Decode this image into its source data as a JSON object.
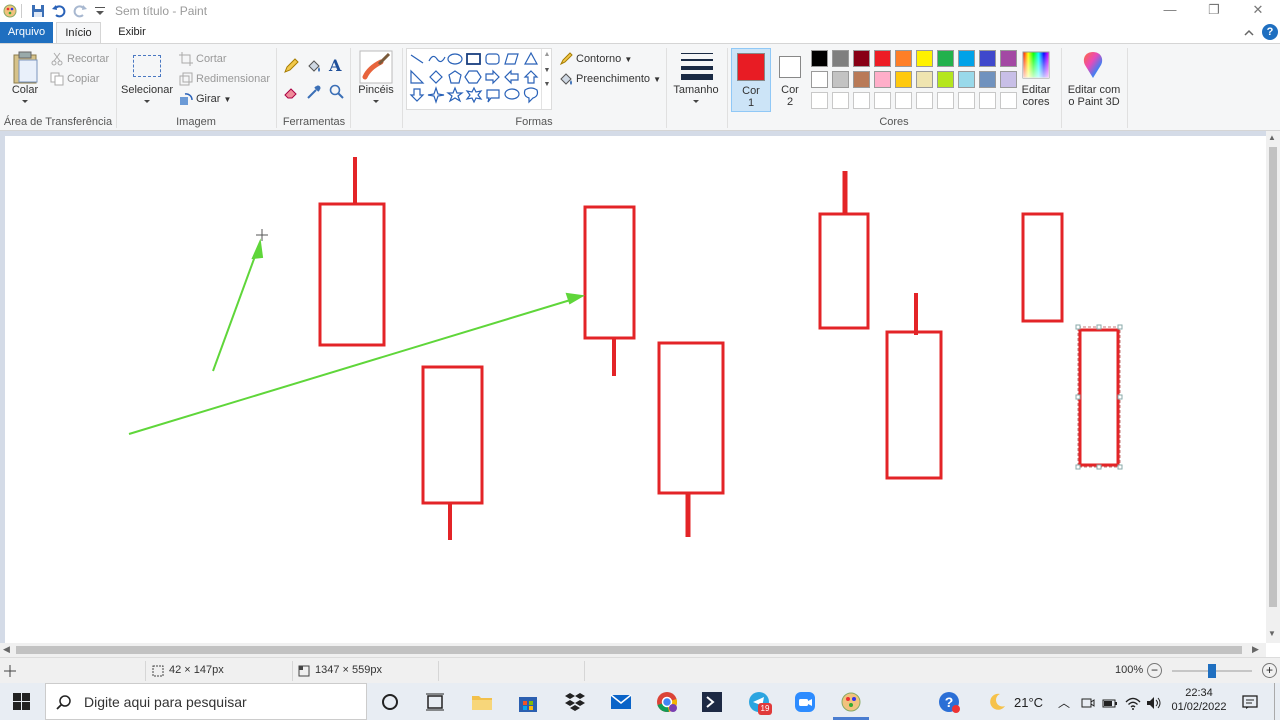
{
  "window": {
    "title": "Sem título - Paint",
    "minimize": "—",
    "restore": "❐",
    "close": "✕",
    "help": "?"
  },
  "menu": {
    "file": "Arquivo",
    "tabs": [
      "Início",
      "Exibir"
    ]
  },
  "ribbon": {
    "clipboard": {
      "paste": "Colar",
      "cut": "Recortar",
      "copy": "Copiar",
      "label": "Área de Transferência"
    },
    "image": {
      "select": "Selecionar",
      "crop": "Cortar",
      "resize": "Redimensionar",
      "rotate": "Girar",
      "label": "Imagem"
    },
    "tools": {
      "label": "Ferramentas"
    },
    "brushes": {
      "label": "Pincéis"
    },
    "shapes": {
      "outline": "Contorno",
      "fill": "Preenchimento",
      "label": "Formas"
    },
    "size": {
      "label": "Tamanho"
    },
    "color1": {
      "line1": "Cor",
      "line2": "1",
      "value": "#e81c24"
    },
    "color2": {
      "line1": "Cor",
      "line2": "2",
      "value": "#ffffff"
    },
    "colors": {
      "label": "Cores",
      "row1": [
        "#000000",
        "#7f7f7f",
        "#880015",
        "#ed1c24",
        "#ff7f27",
        "#fff200",
        "#22b14c",
        "#00a2e8",
        "#3f48cc",
        "#a349a4"
      ],
      "row2": [
        "#ffffff",
        "#c3c3c3",
        "#b97a57",
        "#ffaec9",
        "#ffc90e",
        "#efe4b0",
        "#b5e61d",
        "#99d9ea",
        "#7092be",
        "#c8bfe7"
      ]
    },
    "edit_colors": {
      "line1": "Editar",
      "line2": "cores"
    },
    "paint3d": {
      "line1": "Editar com",
      "line2": "o Paint 3D"
    }
  },
  "status": {
    "selection_size": "42 × 147px",
    "canvas_size": "1347 × 559px",
    "zoom": "100%"
  },
  "taskbar": {
    "search_placeholder": "Digite aqui para pesquisar",
    "weather": "21°C",
    "time": "22:34",
    "date": "01/02/2022",
    "telegram_badge": "19"
  },
  "accent_colors": {
    "drawing_red": "#e32427",
    "arrow_green": "#5fd63a",
    "file_tab": "#1f6fc0"
  }
}
